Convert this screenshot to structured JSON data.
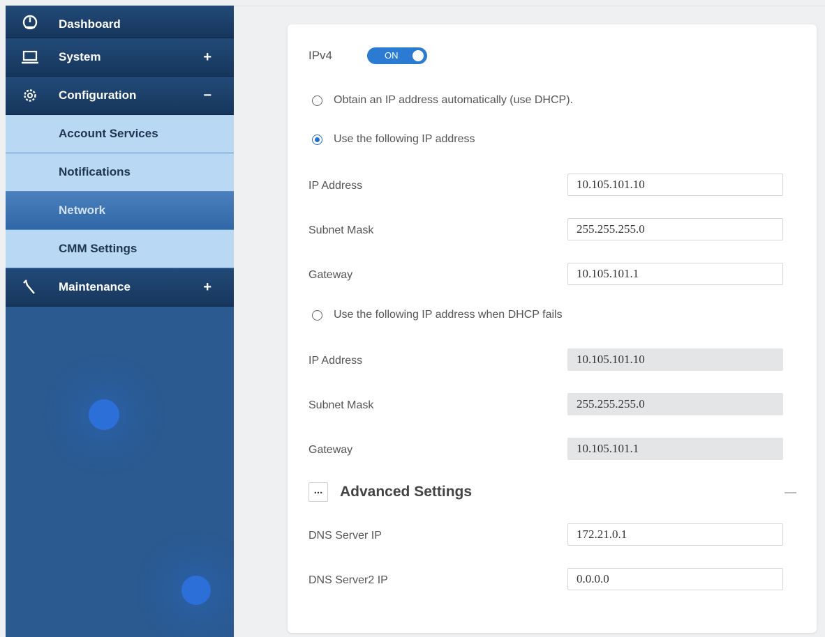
{
  "sidebar": {
    "items": [
      {
        "label": "Dashboard",
        "icon": "dashboard-icon"
      },
      {
        "label": "System",
        "icon": "laptop-icon",
        "toggle": "+"
      },
      {
        "label": "Configuration",
        "icon": "gear-icon",
        "toggle": "−"
      },
      {
        "label": "Maintenance",
        "icon": "wrench-icon",
        "toggle": "+"
      }
    ],
    "subitems": [
      {
        "label": "Account Services"
      },
      {
        "label": "Notifications"
      },
      {
        "label": "Network",
        "active": true
      },
      {
        "label": "CMM Settings"
      }
    ]
  },
  "ipv4": {
    "title": "IPv4",
    "toggle_label": "ON",
    "option_dhcp": "Obtain an IP address automatically (use DHCP).",
    "option_static": "Use the following IP address",
    "static": {
      "ip_label": "IP Address",
      "ip_value": "10.105.101.10",
      "mask_label": "Subnet Mask",
      "mask_value": "255.255.255.0",
      "gw_label": "Gateway",
      "gw_value": "10.105.101.1"
    },
    "option_fallback": "Use the following IP address when DHCP fails",
    "fallback": {
      "ip_label": "IP Address",
      "ip_value": "10.105.101.10",
      "mask_label": "Subnet Mask",
      "mask_value": "255.255.255.0",
      "gw_label": "Gateway",
      "gw_value": "10.105.101.1"
    },
    "selected_option": "static"
  },
  "advanced": {
    "expand_icon_text": "...",
    "title": "Advanced Settings",
    "dns_label": "DNS Server IP",
    "dns_value": "172.21.0.1",
    "dns2_label": "DNS Server2 IP",
    "dns2_value": "0.0.0.0"
  },
  "colors": {
    "sidebar_bg": "#2b5a91",
    "sub_item_bg": "#b8d8f4",
    "active_item_bg": "#3b72b1",
    "toggle_on": "#2a7bd1"
  }
}
